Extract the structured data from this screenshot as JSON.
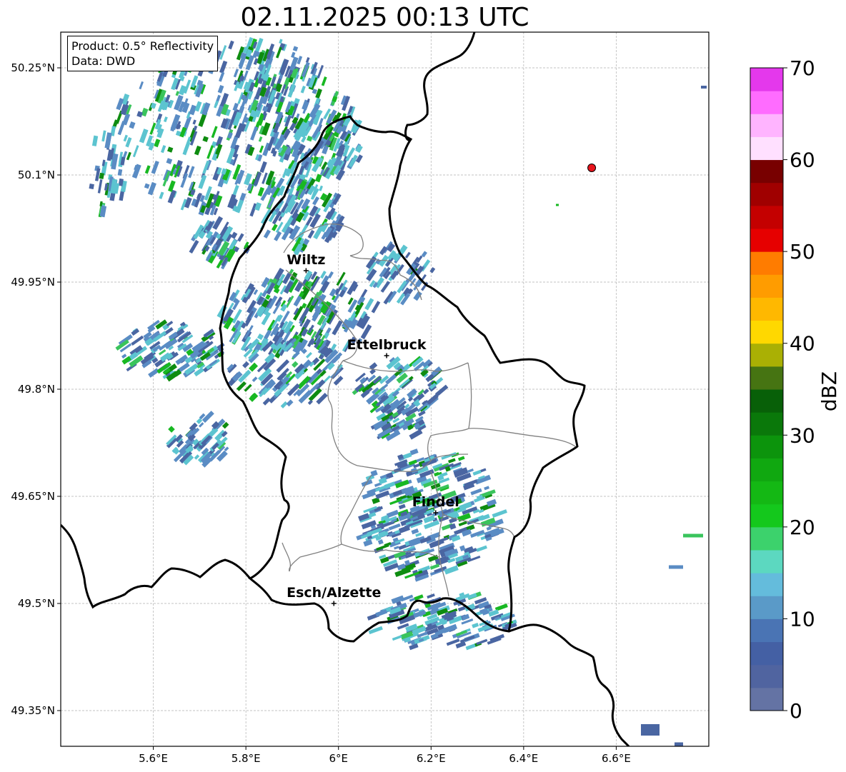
{
  "title": "02.11.2025 00:13 UTC",
  "info": {
    "product": "Product: 0.5° Reflectivity",
    "source": "Data: DWD"
  },
  "map_extent": {
    "lon": [
      5.4,
      6.8
    ],
    "lat": [
      49.3,
      50.3
    ]
  },
  "lon_ticks": [
    {
      "value": 5.6,
      "label": "5.6°E"
    },
    {
      "value": 5.8,
      "label": "5.8°E"
    },
    {
      "value": 6.0,
      "label": "6°E"
    },
    {
      "value": 6.2,
      "label": "6.2°E"
    },
    {
      "value": 6.4,
      "label": "6.4°E"
    },
    {
      "value": 6.6,
      "label": "6.6°E"
    }
  ],
  "lat_ticks": [
    {
      "value": 50.25,
      "label": "50.25°N"
    },
    {
      "value": 50.1,
      "label": "50.1°N"
    },
    {
      "value": 49.95,
      "label": "49.95°N"
    },
    {
      "value": 49.8,
      "label": "49.8°N"
    },
    {
      "value": 49.65,
      "label": "49.65°N"
    },
    {
      "value": 49.5,
      "label": "49.5°N"
    },
    {
      "value": 49.35,
      "label": "49.35°N"
    }
  ],
  "cities": [
    {
      "name": "Wiltz",
      "lon": 5.93,
      "lat": 49.966
    },
    {
      "name": "Ettelbruck",
      "lon": 6.104,
      "lat": 49.847
    },
    {
      "name": "Findel",
      "lon": 6.21,
      "lat": 49.627
    },
    {
      "name": "Esch/Alzette",
      "lon": 5.99,
      "lat": 49.5
    }
  ],
  "radar_site": {
    "lon": 6.547,
    "lat": 50.11,
    "color": "#e8141c"
  },
  "colorbar": {
    "label": "dBZ",
    "min": 0,
    "max": 70,
    "ticks": [
      {
        "value": 0,
        "label": "0"
      },
      {
        "value": 10,
        "label": "10"
      },
      {
        "value": 20,
        "label": "20"
      },
      {
        "value": 30,
        "label": "30"
      },
      {
        "value": 40,
        "label": "40"
      },
      {
        "value": 50,
        "label": "50"
      },
      {
        "value": 60,
        "label": "60"
      },
      {
        "value": 70,
        "label": "70"
      }
    ],
    "colors": [
      "#6473a4",
      "#5064a0",
      "#4460a4",
      "#4a74b4",
      "#5a9ac8",
      "#64bcdc",
      "#5cd8c0",
      "#3cd26c",
      "#14c81c",
      "#14b814",
      "#10a810",
      "#0c940c",
      "#0a780a",
      "#086008",
      "#467412",
      "#aab004",
      "#ffd800",
      "#ffb800",
      "#ff9c00",
      "#ff7c00",
      "#e60000",
      "#c40000",
      "#a00000",
      "#780000",
      "#ffe0ff",
      "#ffb4ff",
      "#ff6cff",
      "#e438ec"
    ]
  },
  "echo_colors": [
    "#4a66a2",
    "#5a8cc4",
    "#5cc4d0",
    "#3ac45c",
    "#18b822",
    "#0e8c10"
  ]
}
